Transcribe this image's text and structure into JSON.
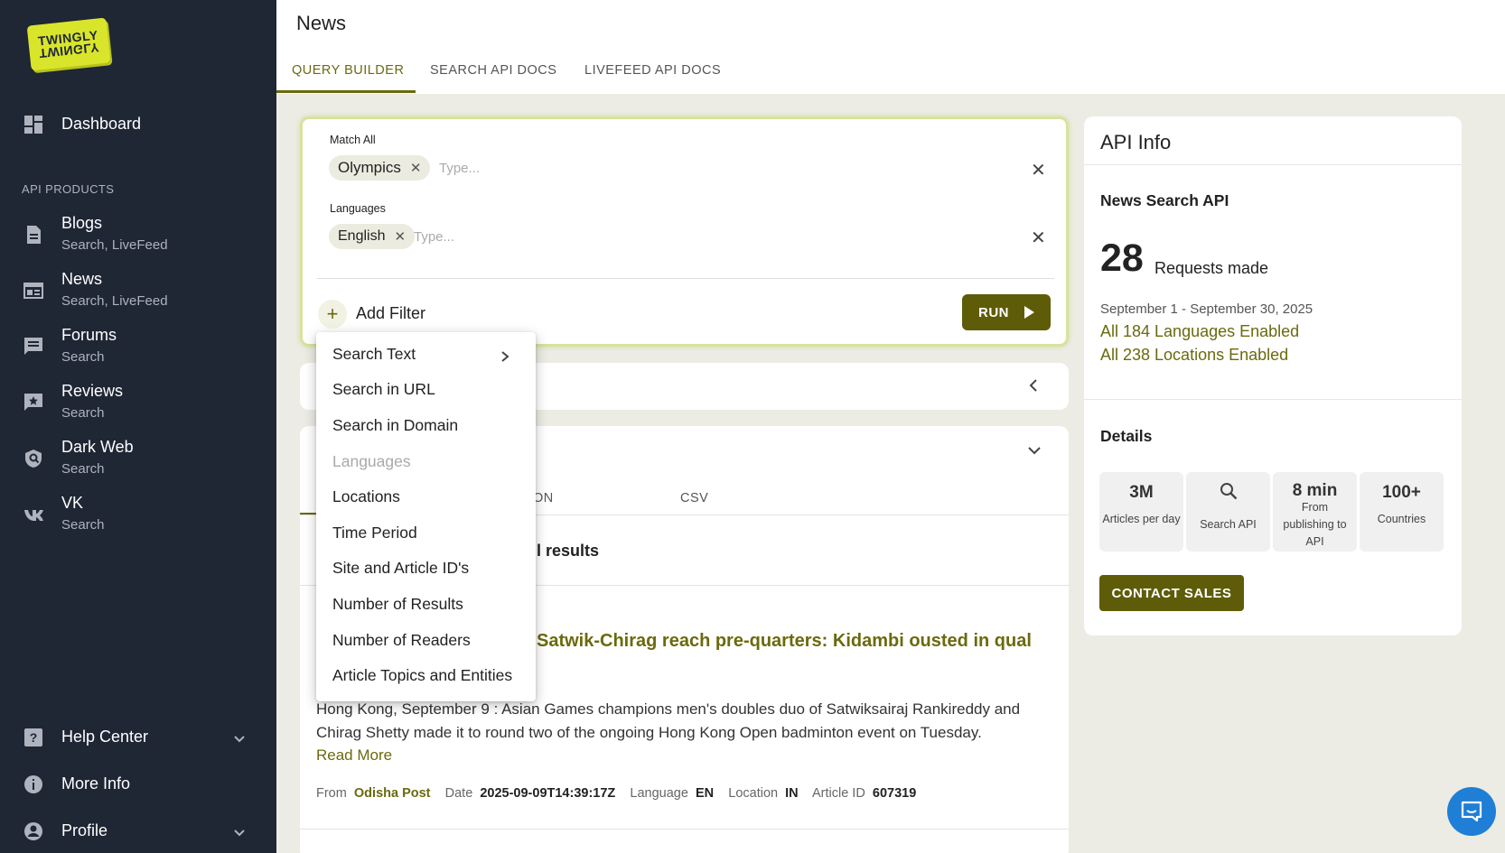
{
  "sidebar": {
    "logo_text": "TWINGLY",
    "dashboard_label": "Dashboard",
    "section_label": "API PRODUCTS",
    "products": [
      {
        "title": "Blogs",
        "sub": "Search, LiveFeed",
        "icon": "document-icon"
      },
      {
        "title": "News",
        "sub": "Search, LiveFeed",
        "icon": "newspaper-icon"
      },
      {
        "title": "Forums",
        "sub": "Search",
        "icon": "chat-icon"
      },
      {
        "title": "Reviews",
        "sub": "Search",
        "icon": "review-icon"
      },
      {
        "title": "Dark Web",
        "sub": "Search",
        "icon": "shield-icon"
      },
      {
        "title": "VK",
        "sub": "Search",
        "icon": "vk-icon"
      }
    ],
    "help_label": "Help Center",
    "more_info_label": "More Info",
    "profile_label": "Profile"
  },
  "header": {
    "title": "News",
    "tabs": [
      "QUERY BUILDER",
      "SEARCH API DOCS",
      "LIVEFEED API DOCS"
    ],
    "active_tab": 0
  },
  "query": {
    "match_all_label": "Match All",
    "match_all_chip": "Olympics",
    "languages_label": "Languages",
    "languages_chip": "English",
    "type_placeholder": "Type...",
    "add_filter_label": "Add Filter",
    "run_label": "RUN"
  },
  "menu": {
    "items": [
      {
        "label": "Search Text",
        "has_submenu": true,
        "disabled": false
      },
      {
        "label": "Search in URL",
        "disabled": false
      },
      {
        "label": "Search in Domain",
        "disabled": false
      },
      {
        "label": "Languages",
        "disabled": true
      },
      {
        "label": "Locations",
        "disabled": false
      },
      {
        "label": "Time Period",
        "disabled": false
      },
      {
        "label": "Site and Article ID's",
        "disabled": false
      },
      {
        "label": "Number of Results",
        "disabled": false
      },
      {
        "label": "Number of Readers",
        "disabled": false
      },
      {
        "label": "Article Topics and Entities",
        "disabled": false
      }
    ]
  },
  "results": {
    "tab_json_partial": "ON",
    "tab_csv": "CSV",
    "count_partial": "l results",
    "article": {
      "title_partial": "Satwik-Chirag reach pre-quarters: Kidambi ousted in qual",
      "body_line1": "Hong Kong, September 9 : Asian Games champions men's doubles duo of Satwiksairaj Rankireddy and",
      "body_line2": "Chirag Shetty made it to round two of the ongoing Hong Kong Open badminton event on Tuesday.",
      "read_more": "Read More",
      "from_label": "From",
      "from_value": "Odisha Post",
      "date_label": "Date",
      "date_value": "2025-09-09T14:39:17Z",
      "language_label": "Language",
      "language_value": "EN",
      "location_label": "Location",
      "location_value": "IN",
      "article_id_label": "Article ID",
      "article_id_value": "607319"
    }
  },
  "api_info": {
    "title": "API Info",
    "product": "News Search API",
    "requests_count": "28",
    "requests_label": "Requests made",
    "period": "September 1 - September 30, 2025",
    "languages_enabled": "All 184 Languages Enabled",
    "locations_enabled": "All 238 Locations Enabled",
    "details_label": "Details",
    "stats": [
      {
        "value": "3M",
        "label": "Articles per day"
      },
      {
        "value": "",
        "label": "Search API",
        "icon": "search-icon"
      },
      {
        "value": "8 min",
        "label_lines": [
          "From",
          "publishing to",
          "API"
        ]
      },
      {
        "value": "100+",
        "label": "Countries"
      }
    ],
    "contact_label": "CONTACT SALES"
  },
  "colors": {
    "sidebar_bg": "#1f2634",
    "accent": "#6b6a0e",
    "button": "#5e5c08",
    "logo": "#d9e52a",
    "chat": "#1f7fd6"
  }
}
